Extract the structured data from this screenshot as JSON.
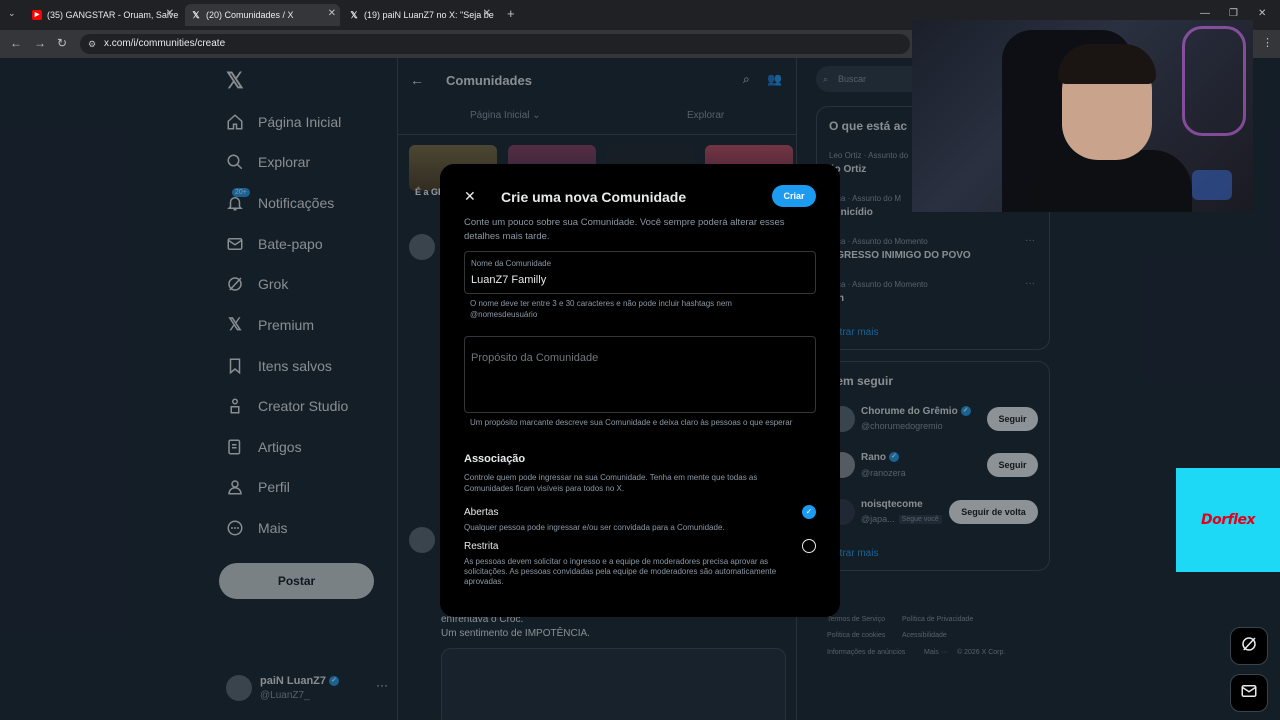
{
  "browser": {
    "tabs": [
      {
        "title": "(35) GANGSTAR - Oruam, Salve",
        "favicon": "youtube-icon"
      },
      {
        "title": "(20) Comunidades / X",
        "favicon": "x-icon"
      },
      {
        "title": "(19) paiN LuanZ7 no X: \"Seja be",
        "favicon": "x-icon"
      }
    ],
    "new_tab": "+",
    "url": "x.com/i/communities/create"
  },
  "nav": {
    "items": [
      {
        "label": "Página Inicial",
        "icon": "home-icon"
      },
      {
        "label": "Explorar",
        "icon": "search-icon"
      },
      {
        "label": "Notificações",
        "icon": "bell-icon",
        "badge": "20+"
      },
      {
        "label": "Bate-papo",
        "icon": "mail-icon"
      },
      {
        "label": "Grok",
        "icon": "grok-icon"
      },
      {
        "label": "Premium",
        "icon": "x-icon"
      },
      {
        "label": "Itens salvos",
        "icon": "bookmark-icon"
      },
      {
        "label": "Creator Studio",
        "icon": "creator-icon"
      },
      {
        "label": "Artigos",
        "icon": "article-icon"
      },
      {
        "label": "Perfil",
        "icon": "person-icon"
      },
      {
        "label": "Mais",
        "icon": "more-icon"
      }
    ],
    "post_button": "Postar",
    "profile": {
      "name": "paiN LuanZ7",
      "handle": "@LuanZ7_"
    }
  },
  "center": {
    "title": "Comunidades",
    "subtabs": [
      "Página Inicial",
      "Explorar"
    ],
    "thumb_caption": "É a GR",
    "feed_lines": [
      "enfrentava o Croc.",
      "Um sentimento de IMPOTÊNCIA."
    ]
  },
  "right": {
    "search_placeholder": "Buscar",
    "trends_title": "O que está ac",
    "trends": [
      {
        "meta": "Leo Ortiz · Assunto do",
        "name": "éo Ortiz"
      },
      {
        "meta": "lítica · Assunto do M",
        "name": "minicídio"
      },
      {
        "meta": "lítica · Assunto do Momento",
        "name": "NGRESSO INIMIGO DO POVO"
      },
      {
        "meta": "lítica · Assunto do Momento",
        "name": "nin"
      }
    ],
    "show_more": "ostrar mais",
    "who_title": "uem seguir",
    "who": [
      {
        "name": "Chorume do Grêmio",
        "handle": "@chorumedogremio",
        "button": "Seguir",
        "verified": true
      },
      {
        "name": "Rano",
        "handle": "@ranozera",
        "button": "Seguir",
        "verified": true
      },
      {
        "name": "noisqtecome",
        "handle": "@japa...",
        "follows_you": "Segue você",
        "button": "Seguir de volta",
        "verified": false
      }
    ],
    "show_more_2": "ostrar mais",
    "footer": [
      "Termos de Serviço",
      "Política de Privacidade",
      "Política de cookies",
      "Acessibilidade",
      "Informações de anúncios",
      "Mais ···",
      "© 2026 X Corp."
    ]
  },
  "modal": {
    "title": "Crie uma nova Comunidade",
    "create_button": "Criar",
    "description": "Conte um pouco sobre sua Comunidade. Você sempre poderá alterar esses detalhes mais tarde.",
    "name_label": "Nome da Comunidade",
    "name_value": "LuanZ7 Familly",
    "name_hint": "O nome deve ter entre 3 e 30 caracteres e não pode incluir hashtags nem @nomesdeusuário",
    "purpose_placeholder": "Propósito da Comunidade",
    "purpose_hint": "Um propósito marcante descreve sua Comunidade e deixa claro às pessoas o que esperar",
    "membership_title": "Associação",
    "membership_desc": "Controle quem pode ingressar na sua Comunidade. Tenha em mente que todas as Comunidades ficam visíveis para todos no X.",
    "options": [
      {
        "title": "Abertas",
        "desc": "Qualquer pessoa pode ingressar e/ou ser convidada para a Comunidade.",
        "selected": true
      },
      {
        "title": "Restrita",
        "desc": "As pessoas devem solicitar o ingresso e a equipe de moderadores precisa aprovar as solicitações. As pessoas convidadas pela equipe de moderadores são automaticamente aprovadas.",
        "selected": false
      }
    ]
  },
  "ad": {
    "brand": "Dorflex"
  },
  "colors": {
    "accent": "#1d9bf0",
    "background": "#15202b",
    "modal": "#000000",
    "ad": "#1ed9f5"
  }
}
